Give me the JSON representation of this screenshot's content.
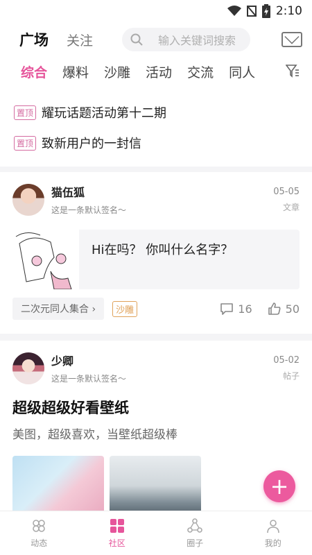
{
  "status": {
    "time": "2:10"
  },
  "header": {
    "tab_main": "广场",
    "tab_follow": "关注",
    "search_placeholder": "输入关键词搜索"
  },
  "categories": [
    "综合",
    "爆料",
    "沙雕",
    "活动",
    "交流",
    "同人"
  ],
  "pinned": [
    {
      "tag": "置顶",
      "text": "耀玩话题活动第十二期"
    },
    {
      "tag": "置顶",
      "text": "致新用户的一封信"
    }
  ],
  "post1": {
    "user": "猫伍狐",
    "sign": "这是一条默认签名～",
    "date": "05-05",
    "type": "文章",
    "quote": "Hi在吗？ 你叫什么名字？",
    "topic": "二次元同人集合",
    "topic_arrow": "›",
    "tag": "沙雕",
    "comments": "16",
    "likes": "50"
  },
  "post2": {
    "user": "少卿",
    "sign": "这是一条默认签名～",
    "date": "05-02",
    "type": "帖子",
    "title": "超级超级好看壁纸",
    "desc": "美图，超级喜欢，当壁纸超级棒"
  },
  "fab": "+",
  "nav": [
    {
      "label": "动态",
      "icon": "dynamic-icon"
    },
    {
      "label": "社区",
      "icon": "community-icon"
    },
    {
      "label": "圈子",
      "icon": "circle-icon"
    },
    {
      "label": "我的",
      "icon": "profile-icon"
    }
  ],
  "colors": {
    "accent": "#e6559b",
    "tag_orange": "#e0a25a",
    "fab": "#ec5a9e"
  }
}
